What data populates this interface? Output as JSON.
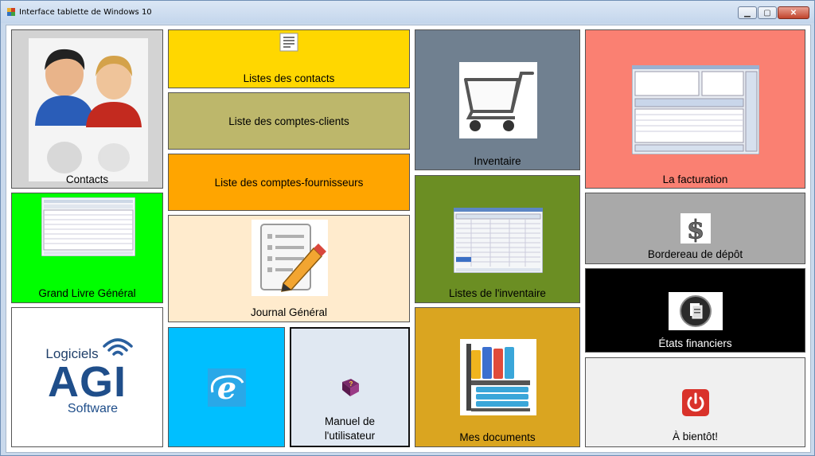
{
  "window": {
    "title": "Interface tablette de Windows 10"
  },
  "tiles": {
    "contacts": "Contacts",
    "contact_list": "Listes des contacts",
    "client_accounts": "Liste des comptes-clients",
    "supplier_accounts": "Liste des comptes-fournisseurs",
    "inventory": "Inventaire",
    "invoicing": "La facturation",
    "general_ledger": "Grand Livre Général",
    "journal": "Journal Général",
    "inventory_lists": "Listes de l'inventaire",
    "deposit_slip": "Bordereau de dépôt",
    "financial_statements": "États financiers",
    "manual_line1": "Manuel de",
    "manual_line2": "l'utilisateur",
    "documents": "Mes documents",
    "goodbye": "À bientôt!"
  },
  "logo": {
    "line1": "Logiciels",
    "brand": "AGI",
    "line2": "Software"
  },
  "colors": {
    "contact_list": "#ffd700",
    "client_accounts": "#bdb76b",
    "supplier_accounts": "#ffa500",
    "inventory": "#708090",
    "invoicing": "#fa8072",
    "general_ledger": "#00ff00",
    "journal": "#ffebcd",
    "internet": "#00bfff",
    "manual": "#e0e8f2",
    "inventory_lists": "#6b8e23",
    "deposit_slip": "#a9a9a9",
    "financial_statements": "#000000",
    "documents": "#daa520",
    "goodbye": "#f0f0f0"
  }
}
